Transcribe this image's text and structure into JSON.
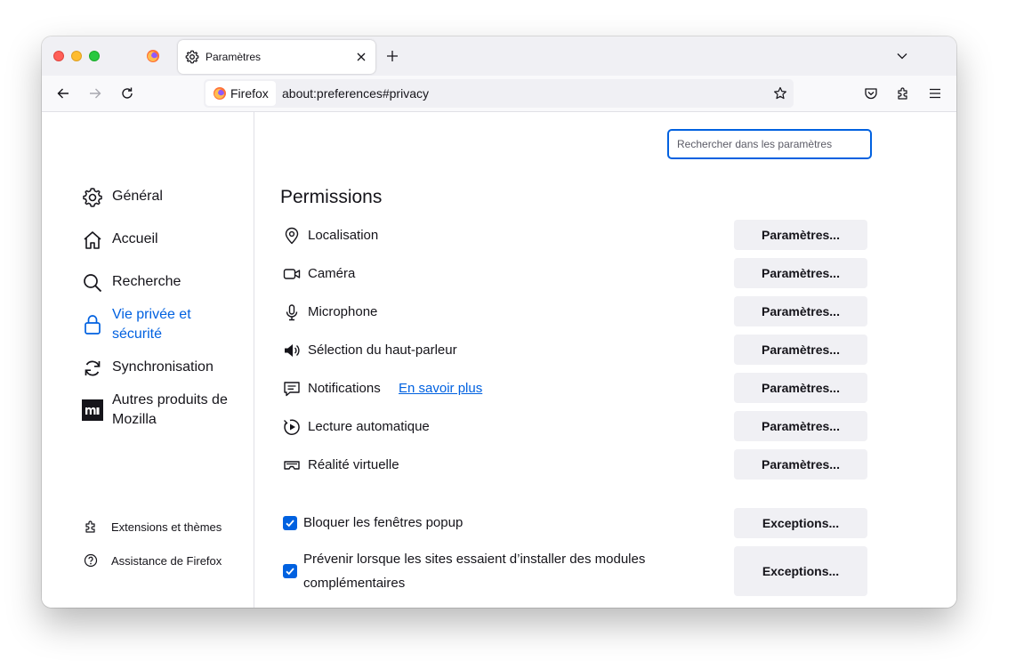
{
  "tab": {
    "title": "Paramètres"
  },
  "urlbar": {
    "identity": "Firefox",
    "url": "about:preferences#privacy"
  },
  "search": {
    "placeholder": "Rechercher dans les paramètres"
  },
  "sidebar": {
    "categories": [
      {
        "label": "Général",
        "icon": "gear-icon"
      },
      {
        "label": "Accueil",
        "icon": "home-icon"
      },
      {
        "label": "Recherche",
        "icon": "search-icon"
      },
      {
        "label": "Vie privée et sécurité",
        "icon": "lock-icon",
        "selected": true
      },
      {
        "label": "Synchronisation",
        "icon": "sync-icon"
      },
      {
        "label": "Autres produits de Mozilla",
        "icon": "mozilla-logo-icon"
      }
    ],
    "footer": [
      {
        "label": "Extensions et thèmes",
        "icon": "puzzle-icon"
      },
      {
        "label": "Assistance de Firefox",
        "icon": "help-icon"
      }
    ]
  },
  "permissions": {
    "title": "Permissions",
    "button_label": "Paramètres...",
    "learn_more": "En savoir plus",
    "rows": [
      {
        "label": "Localisation",
        "icon": "location-icon"
      },
      {
        "label": "Caméra",
        "icon": "camera-icon"
      },
      {
        "label": "Microphone",
        "icon": "microphone-icon"
      },
      {
        "label": "Sélection du haut-parleur",
        "icon": "speaker-icon"
      },
      {
        "label": "Notifications",
        "icon": "notification-icon"
      },
      {
        "label": "Lecture automatique",
        "icon": "autoplay-icon"
      },
      {
        "label": "Réalité virtuelle",
        "icon": "vr-icon"
      }
    ],
    "checks": [
      {
        "label": "Bloquer les fenêtres popup",
        "checked": true,
        "button": "Exceptions..."
      },
      {
        "label": "Prévenir lorsque les sites essaient d’installer des modules complémentaires",
        "checked": true,
        "button": "Exceptions..."
      }
    ]
  },
  "colors": {
    "accent": "#0061e0",
    "button_bg": "#f0f0f4",
    "text": "#15141a"
  }
}
